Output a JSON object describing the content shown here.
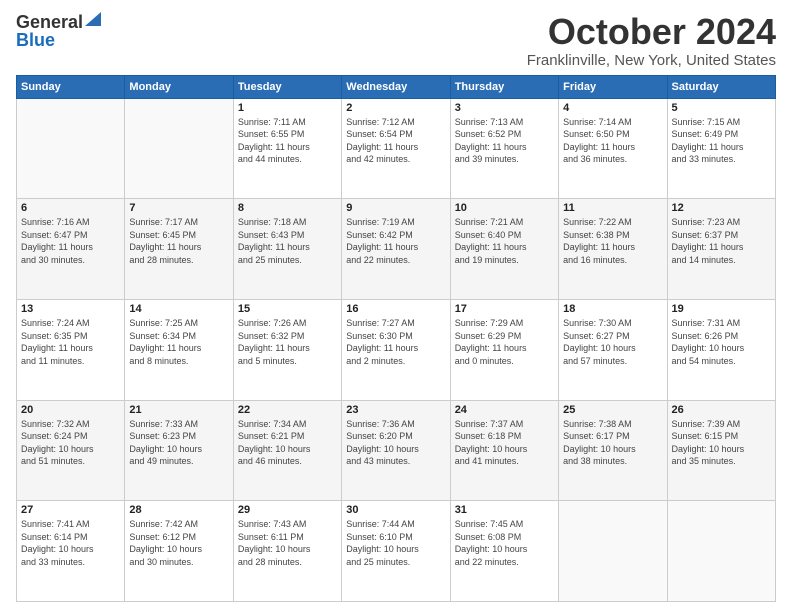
{
  "logo": {
    "general": "General",
    "blue": "Blue"
  },
  "title": "October 2024",
  "location": "Franklinville, New York, United States",
  "days_header": [
    "Sunday",
    "Monday",
    "Tuesday",
    "Wednesday",
    "Thursday",
    "Friday",
    "Saturday"
  ],
  "weeks": [
    [
      {
        "num": "",
        "detail": ""
      },
      {
        "num": "",
        "detail": ""
      },
      {
        "num": "1",
        "detail": "Sunrise: 7:11 AM\nSunset: 6:55 PM\nDaylight: 11 hours\nand 44 minutes."
      },
      {
        "num": "2",
        "detail": "Sunrise: 7:12 AM\nSunset: 6:54 PM\nDaylight: 11 hours\nand 42 minutes."
      },
      {
        "num": "3",
        "detail": "Sunrise: 7:13 AM\nSunset: 6:52 PM\nDaylight: 11 hours\nand 39 minutes."
      },
      {
        "num": "4",
        "detail": "Sunrise: 7:14 AM\nSunset: 6:50 PM\nDaylight: 11 hours\nand 36 minutes."
      },
      {
        "num": "5",
        "detail": "Sunrise: 7:15 AM\nSunset: 6:49 PM\nDaylight: 11 hours\nand 33 minutes."
      }
    ],
    [
      {
        "num": "6",
        "detail": "Sunrise: 7:16 AM\nSunset: 6:47 PM\nDaylight: 11 hours\nand 30 minutes."
      },
      {
        "num": "7",
        "detail": "Sunrise: 7:17 AM\nSunset: 6:45 PM\nDaylight: 11 hours\nand 28 minutes."
      },
      {
        "num": "8",
        "detail": "Sunrise: 7:18 AM\nSunset: 6:43 PM\nDaylight: 11 hours\nand 25 minutes."
      },
      {
        "num": "9",
        "detail": "Sunrise: 7:19 AM\nSunset: 6:42 PM\nDaylight: 11 hours\nand 22 minutes."
      },
      {
        "num": "10",
        "detail": "Sunrise: 7:21 AM\nSunset: 6:40 PM\nDaylight: 11 hours\nand 19 minutes."
      },
      {
        "num": "11",
        "detail": "Sunrise: 7:22 AM\nSunset: 6:38 PM\nDaylight: 11 hours\nand 16 minutes."
      },
      {
        "num": "12",
        "detail": "Sunrise: 7:23 AM\nSunset: 6:37 PM\nDaylight: 11 hours\nand 14 minutes."
      }
    ],
    [
      {
        "num": "13",
        "detail": "Sunrise: 7:24 AM\nSunset: 6:35 PM\nDaylight: 11 hours\nand 11 minutes."
      },
      {
        "num": "14",
        "detail": "Sunrise: 7:25 AM\nSunset: 6:34 PM\nDaylight: 11 hours\nand 8 minutes."
      },
      {
        "num": "15",
        "detail": "Sunrise: 7:26 AM\nSunset: 6:32 PM\nDaylight: 11 hours\nand 5 minutes."
      },
      {
        "num": "16",
        "detail": "Sunrise: 7:27 AM\nSunset: 6:30 PM\nDaylight: 11 hours\nand 2 minutes."
      },
      {
        "num": "17",
        "detail": "Sunrise: 7:29 AM\nSunset: 6:29 PM\nDaylight: 11 hours\nand 0 minutes."
      },
      {
        "num": "18",
        "detail": "Sunrise: 7:30 AM\nSunset: 6:27 PM\nDaylight: 10 hours\nand 57 minutes."
      },
      {
        "num": "19",
        "detail": "Sunrise: 7:31 AM\nSunset: 6:26 PM\nDaylight: 10 hours\nand 54 minutes."
      }
    ],
    [
      {
        "num": "20",
        "detail": "Sunrise: 7:32 AM\nSunset: 6:24 PM\nDaylight: 10 hours\nand 51 minutes."
      },
      {
        "num": "21",
        "detail": "Sunrise: 7:33 AM\nSunset: 6:23 PM\nDaylight: 10 hours\nand 49 minutes."
      },
      {
        "num": "22",
        "detail": "Sunrise: 7:34 AM\nSunset: 6:21 PM\nDaylight: 10 hours\nand 46 minutes."
      },
      {
        "num": "23",
        "detail": "Sunrise: 7:36 AM\nSunset: 6:20 PM\nDaylight: 10 hours\nand 43 minutes."
      },
      {
        "num": "24",
        "detail": "Sunrise: 7:37 AM\nSunset: 6:18 PM\nDaylight: 10 hours\nand 41 minutes."
      },
      {
        "num": "25",
        "detail": "Sunrise: 7:38 AM\nSunset: 6:17 PM\nDaylight: 10 hours\nand 38 minutes."
      },
      {
        "num": "26",
        "detail": "Sunrise: 7:39 AM\nSunset: 6:15 PM\nDaylight: 10 hours\nand 35 minutes."
      }
    ],
    [
      {
        "num": "27",
        "detail": "Sunrise: 7:41 AM\nSunset: 6:14 PM\nDaylight: 10 hours\nand 33 minutes."
      },
      {
        "num": "28",
        "detail": "Sunrise: 7:42 AM\nSunset: 6:12 PM\nDaylight: 10 hours\nand 30 minutes."
      },
      {
        "num": "29",
        "detail": "Sunrise: 7:43 AM\nSunset: 6:11 PM\nDaylight: 10 hours\nand 28 minutes."
      },
      {
        "num": "30",
        "detail": "Sunrise: 7:44 AM\nSunset: 6:10 PM\nDaylight: 10 hours\nand 25 minutes."
      },
      {
        "num": "31",
        "detail": "Sunrise: 7:45 AM\nSunset: 6:08 PM\nDaylight: 10 hours\nand 22 minutes."
      },
      {
        "num": "",
        "detail": ""
      },
      {
        "num": "",
        "detail": ""
      }
    ]
  ]
}
